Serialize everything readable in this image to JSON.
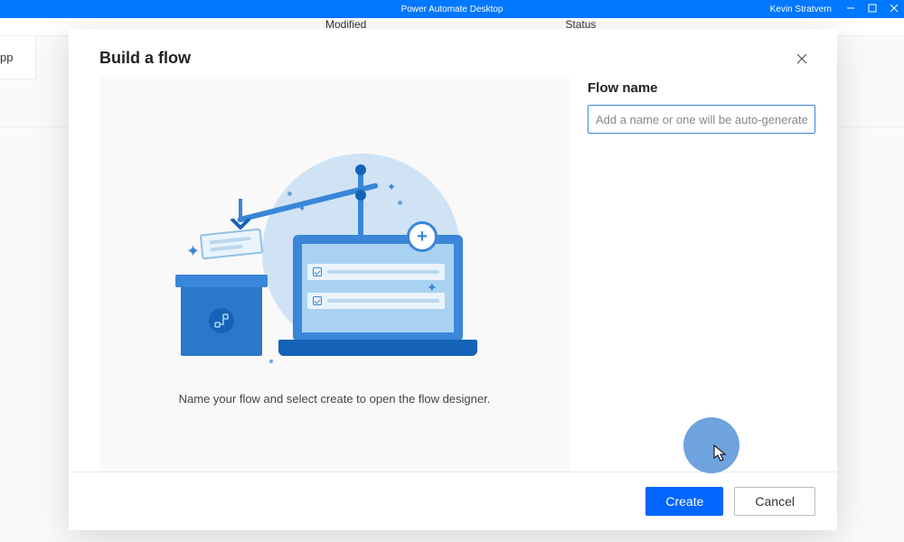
{
  "titlebar": {
    "app_title": "Power Automate Desktop",
    "user_name": "Kevin Stratvern"
  },
  "background": {
    "col_modified": "Modified",
    "col_status": "Status",
    "sidebar_text": "pp"
  },
  "modal": {
    "title": "Build a flow",
    "help_text": "Name your flow and select create to open the flow designer.",
    "form": {
      "label": "Flow name",
      "placeholder": "Add a name or one will be auto-generated",
      "value": ""
    },
    "buttons": {
      "create": "Create",
      "cancel": "Cancel"
    }
  }
}
